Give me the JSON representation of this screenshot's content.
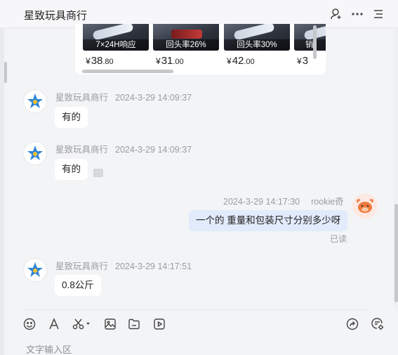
{
  "header": {
    "title": "星致玩具商行"
  },
  "products": [
    {
      "caption": "7×24H响应",
      "currency": "¥",
      "price_int": "38",
      "price_dec": ".80"
    },
    {
      "caption": "回头率26%",
      "currency": "¥",
      "price_int": "31",
      "price_dec": ".00"
    },
    {
      "caption": "回头率30%",
      "currency": "¥",
      "price_int": "42",
      "price_dec": ".00"
    },
    {
      "caption": "销",
      "currency": "¥",
      "price_int": "3",
      "price_dec": ""
    }
  ],
  "messages": [
    {
      "sender": "星致玩具商行",
      "time": "2024-3-29 14:09:37",
      "text": "有的"
    },
    {
      "sender": "星致玩具商行",
      "time": "2024-3-29 14:09:37",
      "text": "有的"
    },
    {
      "sender": "rookie奇",
      "time": "2024-3-29 14:17:30",
      "text": "一个的 重量和包装尺寸分别多少呀",
      "status": "已读"
    },
    {
      "sender": "星致玩具商行",
      "time": "2024-3-29 14:17:51",
      "text": "0.8公斤"
    }
  ],
  "toolbar": {
    "icons": [
      "emoji-icon",
      "font-icon",
      "scissors-icon",
      "image-icon",
      "folder-icon",
      "video-icon",
      "share-icon",
      "settings-chat-icon"
    ]
  },
  "input": {
    "placeholder": "文字输入区"
  }
}
